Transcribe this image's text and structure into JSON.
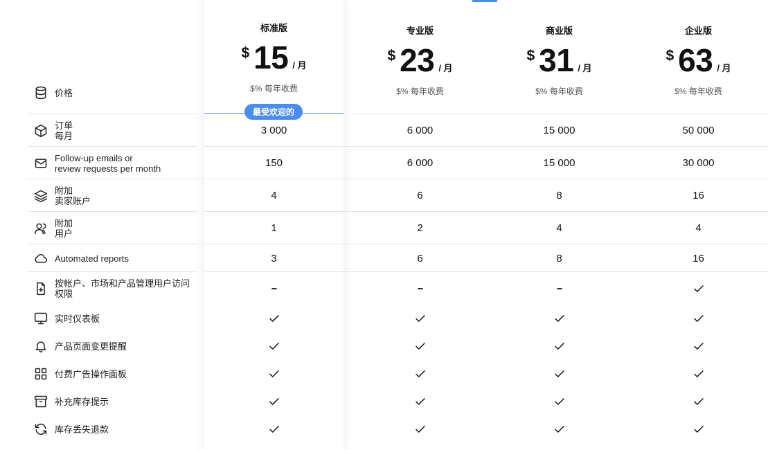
{
  "price_feature_label": "价格",
  "popular_badge": "最受欢迎的",
  "plans": [
    {
      "name": "标准版",
      "currency": "$",
      "amount": "15",
      "period": "/ 月",
      "note": "$% 每年收费"
    },
    {
      "name": "专业版",
      "currency": "$",
      "amount": "23",
      "period": "/ 月",
      "note": "$% 每年收费"
    },
    {
      "name": "商业版",
      "currency": "$",
      "amount": "31",
      "period": "/ 月",
      "note": "$% 每年收费"
    },
    {
      "name": "企业版",
      "currency": "$",
      "amount": "63",
      "period": "/ 月",
      "note": "$% 每年收费"
    }
  ],
  "features": [
    {
      "label": "订单\n每月",
      "icon": "box-icon",
      "values": [
        "3 000",
        "6 000",
        "15 000",
        "50 000"
      ]
    },
    {
      "label": "Follow-up emails or\nreview requests per month",
      "icon": "mail-icon",
      "values": [
        "150",
        "6 000",
        "15 000",
        "30 000"
      ]
    },
    {
      "label": "附加\n卖家账户",
      "icon": "layers-icon",
      "values": [
        "4",
        "6",
        "8",
        "16"
      ]
    },
    {
      "label": "附加\n用户",
      "icon": "users-icon",
      "values": [
        "1",
        "2",
        "4",
        "4"
      ]
    },
    {
      "label": "Automated reports",
      "icon": "cloud-icon",
      "values": [
        "3",
        "6",
        "8",
        "16"
      ]
    },
    {
      "label": "按帐户、市场和产品管理用户访问\n权限",
      "icon": "file-plus-icon",
      "values": [
        "dash",
        "dash",
        "dash",
        "check"
      ]
    },
    {
      "label": "实时仪表板",
      "icon": "monitor-icon",
      "values": [
        "check",
        "check",
        "check",
        "check"
      ]
    },
    {
      "label": "产品页面变更提醒",
      "icon": "bell-icon",
      "values": [
        "check",
        "check",
        "check",
        "check"
      ]
    },
    {
      "label": "付费广告操作面板",
      "icon": "grid-icon",
      "values": [
        "check",
        "check",
        "check",
        "check"
      ]
    },
    {
      "label": "补充库存提示",
      "icon": "archive-icon",
      "values": [
        "check",
        "check",
        "check",
        "check"
      ]
    },
    {
      "label": "库存丢失退款",
      "icon": "refresh-icon",
      "values": [
        "check",
        "check",
        "check",
        "check"
      ]
    }
  ]
}
